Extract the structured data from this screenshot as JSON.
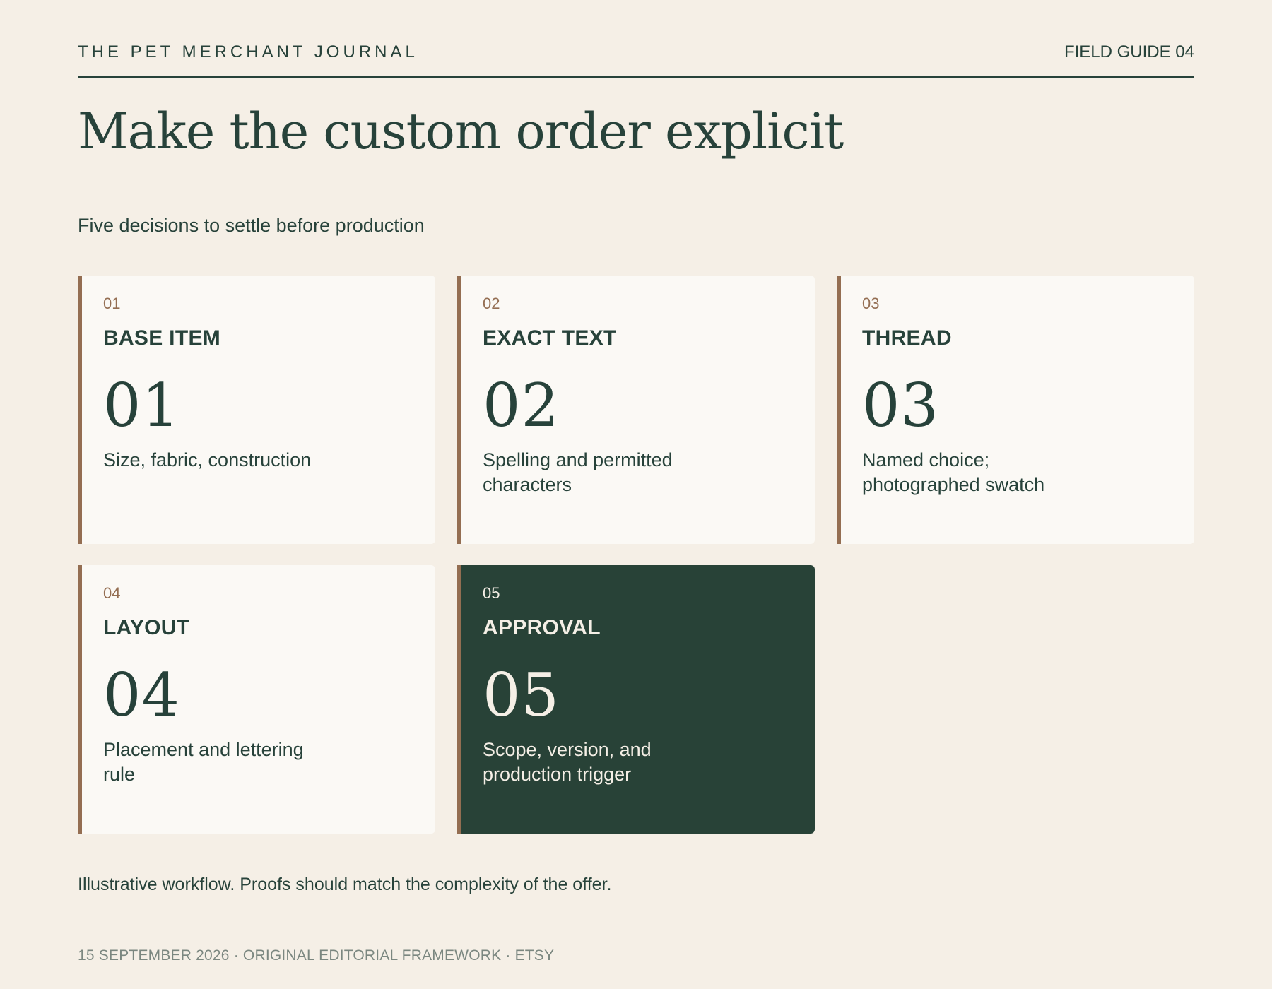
{
  "header": {
    "publication": "THE PET MERCHANT JOURNAL",
    "guide_label": "FIELD GUIDE 04"
  },
  "title": "Make the custom order explicit",
  "subtitle": "Five decisions to settle before production",
  "cards": [
    {
      "index": "01",
      "heading": "BASE ITEM",
      "number": "01",
      "description": "Size, fabric, construction"
    },
    {
      "index": "02",
      "heading": "EXACT TEXT",
      "number": "02",
      "description": "Spelling and permitted characters"
    },
    {
      "index": "03",
      "heading": "THREAD",
      "number": "03",
      "description": "Named choice; photographed swatch"
    },
    {
      "index": "04",
      "heading": "LAYOUT",
      "number": "04",
      "description": "Placement and lettering rule"
    },
    {
      "index": "05",
      "heading": "APPROVAL",
      "number": "05",
      "description": "Scope, version, and production trigger"
    }
  ],
  "note": "Illustrative workflow. Proofs should match the complexity of the offer.",
  "footer": "15 SEPTEMBER 2026 · ORIGINAL EDITORIAL FRAMEWORK · ETSY",
  "colors": {
    "background": "#f5efe6",
    "ink": "#27423a",
    "accent": "#946e52",
    "card": "#fbf9f5",
    "featured_card": "#284237",
    "muted": "#7b8780"
  }
}
